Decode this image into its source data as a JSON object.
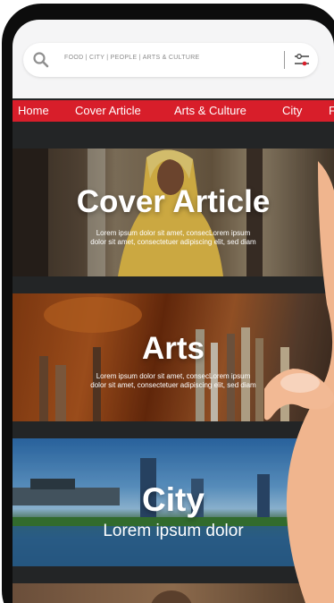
{
  "search": {
    "placeholder": "FOOD | CITY | PEOPLE | ARTS & CULTURE"
  },
  "nav": {
    "items": [
      "Home",
      "Cover Article",
      "Arts & Culture",
      "City",
      "F"
    ]
  },
  "cards": [
    {
      "title": "Cover Article",
      "description_line1": "Lorem ipsum dolor sit amet, consecLorem ipsum",
      "description_line2": "dolor sit amet, consectetuer adipiscing elit, sed diam"
    },
    {
      "title": "Arts",
      "description_line1": "Lorem ipsum dolor sit amet, consecLorem ipsum",
      "description_line2": "dolor sit amet, consectetuer adipiscing elit, sed diam"
    },
    {
      "title": "City",
      "subtitle": "Lorem ipsum dolor"
    }
  ],
  "colors": {
    "accent": "#d81e2a",
    "background": "#232526",
    "search_bg": "#f5f5f6"
  }
}
